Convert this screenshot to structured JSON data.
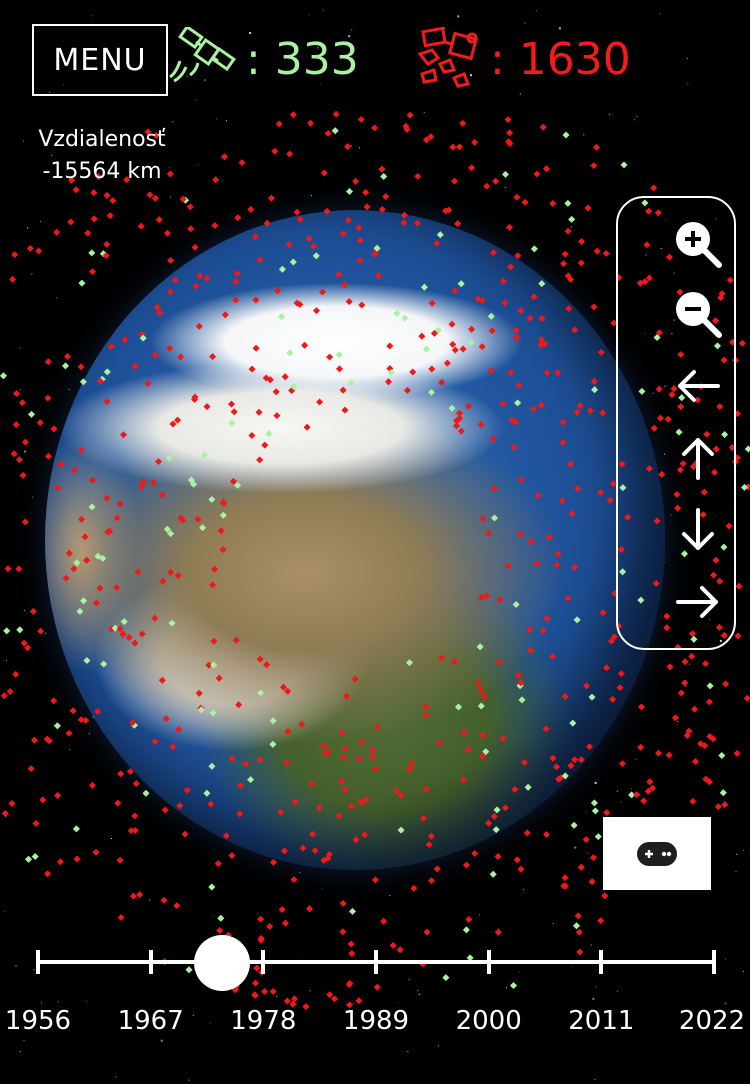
{
  "menu": {
    "label": "MENU"
  },
  "counters": {
    "satellites": {
      "icon": "satellite-icon",
      "text": ": 333",
      "color": "#a8f2a0"
    },
    "debris": {
      "icon": "debris-icon",
      "text": ": 1630",
      "color": "#f41b1b"
    }
  },
  "distance": {
    "label": "Vzdialenosť",
    "value": "-15564 km"
  },
  "nav_controls": [
    {
      "name": "zoom-in-button",
      "icon": "zoom-in-icon"
    },
    {
      "name": "zoom-out-button",
      "icon": "zoom-out-icon"
    },
    {
      "name": "pan-left-button",
      "icon": "arrow-left-icon"
    },
    {
      "name": "pan-up-button",
      "icon": "arrow-up-icon"
    },
    {
      "name": "pan-down-button",
      "icon": "arrow-down-icon"
    },
    {
      "name": "pan-right-button",
      "icon": "arrow-right-icon"
    }
  ],
  "gamepad": {
    "icon": "gamepad-icon"
  },
  "timeline": {
    "years": [
      "1956",
      "1967",
      "1978",
      "1989",
      "2000",
      "2011",
      "2022"
    ],
    "selected_fraction": 0.272
  }
}
